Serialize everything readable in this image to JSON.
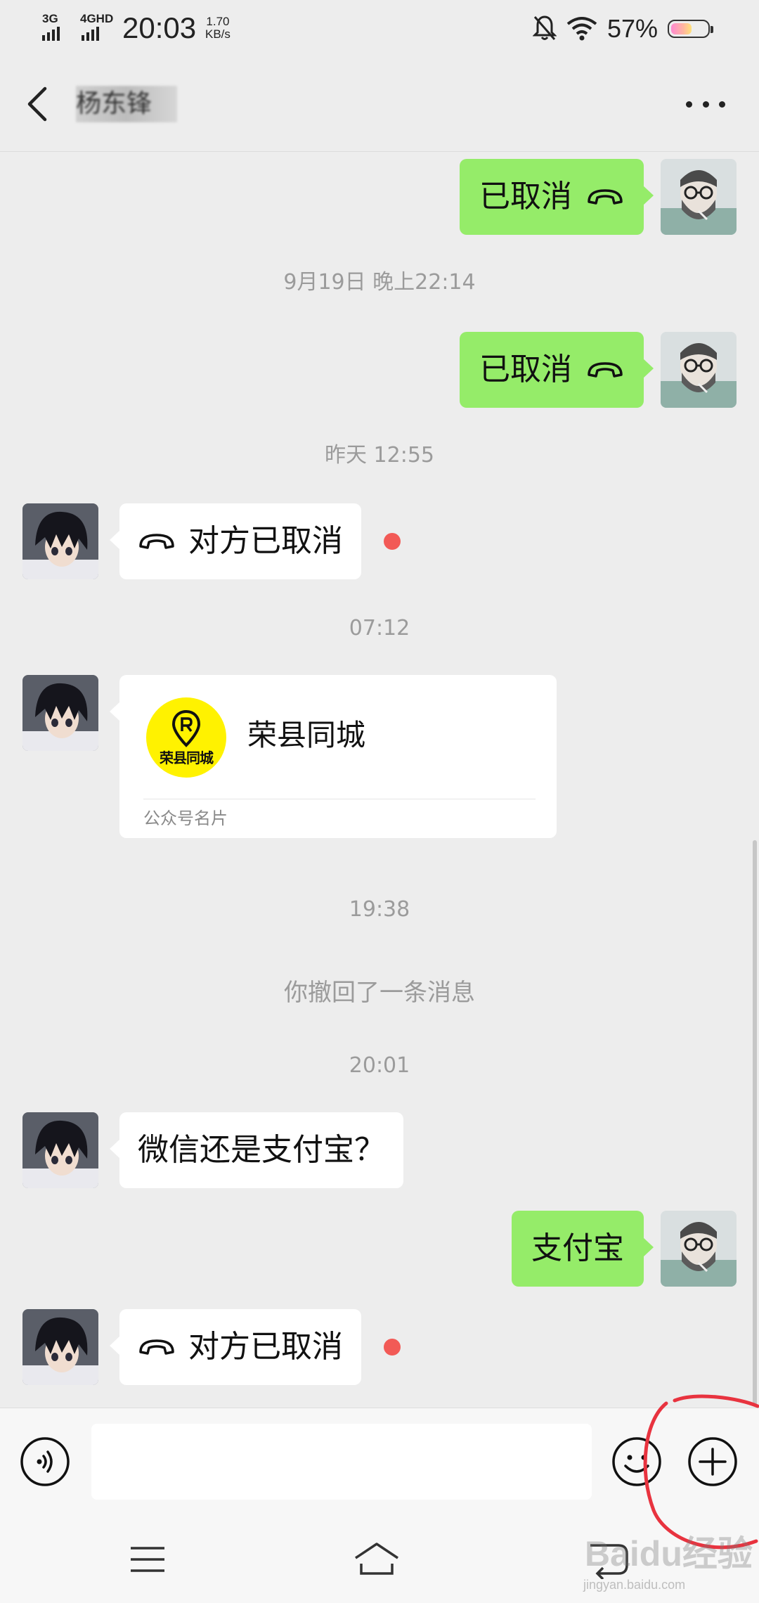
{
  "status_bar": {
    "network_1": "3G",
    "network_2": "4GHD",
    "time": "20:03",
    "speed_value": "1.70",
    "speed_unit": "KB/s",
    "battery": "57%",
    "icons": [
      "signal-icon",
      "mute-bell-icon",
      "wifi-icon",
      "battery-icon"
    ]
  },
  "header": {
    "contact_name": "杨东锋",
    "back_icon": "chevron-left-icon",
    "more_icon": "more-dots-icon"
  },
  "messages": [
    {
      "type": "call",
      "direction": "sent",
      "text": "已取消",
      "icon": "hangup-phone-icon"
    },
    {
      "type": "timestamp",
      "text": "9月19日 晚上22:14"
    },
    {
      "type": "call",
      "direction": "sent",
      "text": "已取消",
      "icon": "hangup-phone-icon"
    },
    {
      "type": "timestamp",
      "text": "昨天 12:55"
    },
    {
      "type": "call",
      "direction": "received",
      "text": "对方已取消",
      "icon": "hangup-phone-icon",
      "unread": true
    },
    {
      "type": "timestamp",
      "text": "07:12"
    },
    {
      "type": "card",
      "direction": "received",
      "title": "荣县同城",
      "logo_text": "荣县同城",
      "card_type": "公众号名片"
    },
    {
      "type": "timestamp",
      "text": "19:38"
    },
    {
      "type": "system",
      "text": "你撤回了一条消息"
    },
    {
      "type": "timestamp",
      "text": "20:01"
    },
    {
      "type": "text",
      "direction": "received",
      "text": "微信还是支付宝？"
    },
    {
      "type": "text",
      "direction": "sent",
      "text": "支付宝"
    },
    {
      "type": "call",
      "direction": "received",
      "text": "对方已取消",
      "icon": "hangup-phone-icon",
      "unread": true
    }
  ],
  "input_bar": {
    "placeholder": "",
    "value": "",
    "voice_icon": "voice-icon",
    "emoji_icon": "emoji-icon",
    "plus_icon": "plus-circle-icon"
  },
  "nav_bar": {
    "icons": [
      "menu-icon",
      "home-icon",
      "back-icon"
    ]
  },
  "watermark": {
    "text": "Baidu经验",
    "url": "jingyan.baidu.com"
  },
  "colors": {
    "background": "#ededed",
    "sent_bubble": "#95ec69",
    "received_bubble": "#ffffff",
    "unread_dot": "#f25a56",
    "annotation_circle": "#e8333f",
    "card_logo": "#fff200"
  }
}
